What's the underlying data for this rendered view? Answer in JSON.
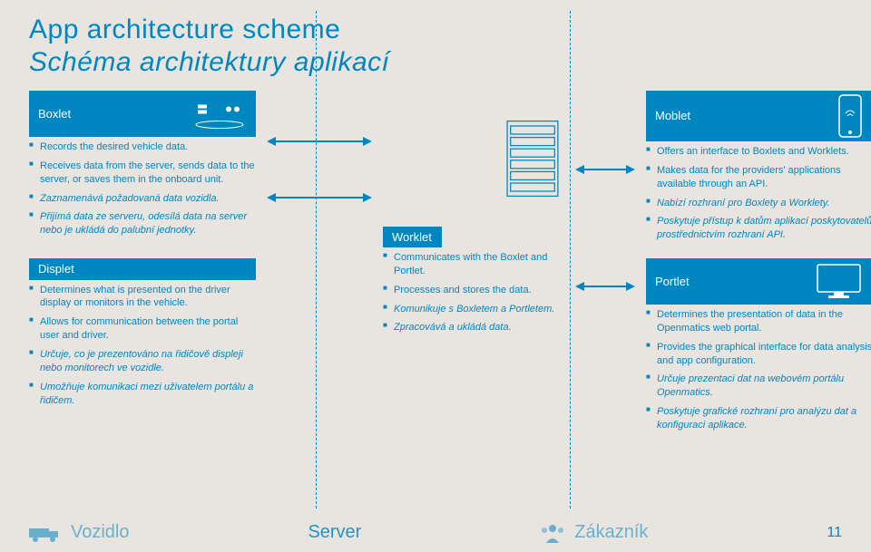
{
  "title_en": "App architecture scheme",
  "title_cz": "Schéma architektury aplikací",
  "boxlet": {
    "name": "Boxlet",
    "b1": "Records the desired vehicle data.",
    "b2": "Receives data from the server, sends data to the server, or saves them in the onboard unit.",
    "b3": "Zaznamenává požadovaná data vozidla.",
    "b4": "Přijímá data ze serveru, odesílá data na server nebo je ukládá do palubní jednotky."
  },
  "moblet": {
    "name": "Moblet",
    "b1": "Offers an interface to Boxlets and Worklets.",
    "b2": "Makes data for the providers' applications available through an API.",
    "b3": "Nabízí rozhraní pro Boxlety a Worklety.",
    "b4": "Poskytuje přístup k datům aplikací poskytovatelů prostřednictvím rozhraní API."
  },
  "worklet": {
    "name": "Worklet",
    "b1": "Communicates with the Boxlet and Portlet.",
    "b2": "Processes and stores the data.",
    "b3": "Komunikuje s Boxletem a Portletem.",
    "b4": "Zpracovává a ukládá data."
  },
  "displet": {
    "name": "Displet",
    "b1": "Determines what is presented on the driver display or monitors in the vehicle.",
    "b2": "Allows for communication between the portal user and driver.",
    "b3": "Určuje, co je prezentováno na řidičově displeji nebo monitorech ve vozidle.",
    "b4": "Umožňuje komunikaci mezi uživatelem portálu a řidičem."
  },
  "portlet": {
    "name": "Portlet",
    "b1": "Determines the presentation of data in the Openmatics web portal.",
    "b2": "Provides the graphical interface for data analysis and app configuration.",
    "b3": "Určuje prezentaci dat na webovém portálu Openmatics.",
    "b4": "Poskytuje grafické rozhraní pro analýzu dat a konfiguraci aplikace."
  },
  "footer": {
    "vehicle": "Vozidlo",
    "server": "Server",
    "customer": "Zákazník",
    "page": "11"
  }
}
